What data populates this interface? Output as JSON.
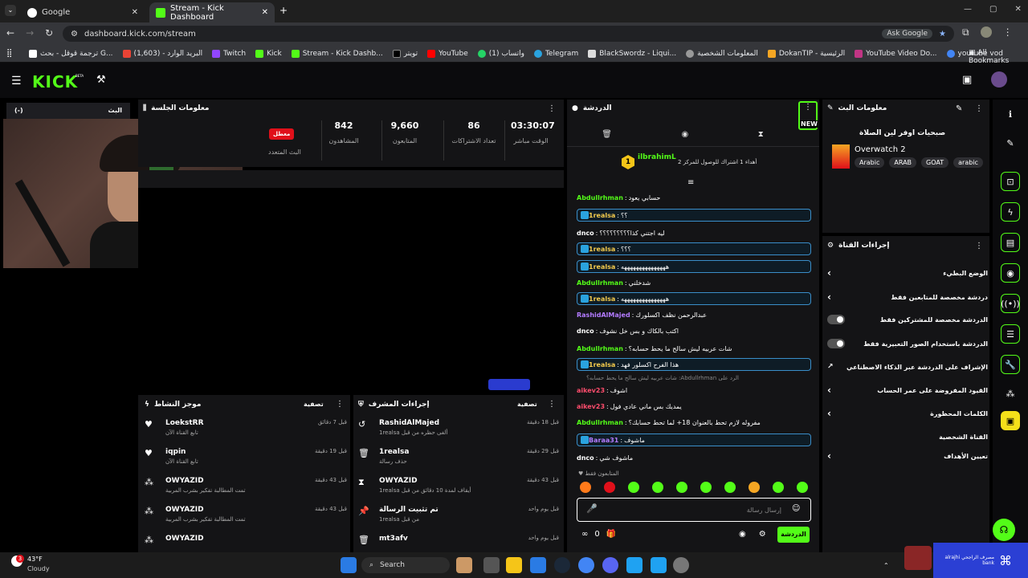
{
  "browser": {
    "tabs": [
      {
        "label": "Google",
        "active": false
      },
      {
        "label": "Stream - Kick Dashboard",
        "active": true
      }
    ],
    "url": "dashboard.kick.com/stream",
    "ask_google": "Ask Google",
    "bookmarks": [
      "ترجمة قوقل - بحث G...",
      "البريد الوارد - (1,603)",
      "Twitch",
      "Kick",
      "Stream - Kick Dashb...",
      "تويتر",
      "YouTube",
      "واتساب (1)",
      "Telegram",
      "BlackSwordz - Liqui...",
      "المعلومات الشخصية",
      "DokanTIP - الرئيسية",
      "YouTube Video Do...",
      "youtube vod"
    ],
    "all_bookmarks": "All Bookmarks"
  },
  "header": {
    "logo": "KICK",
    "beta": "BETA"
  },
  "session": {
    "title": "معلومات الجلسة",
    "status_badge": "معطل",
    "status_label": "البث المتعدد",
    "stats": [
      {
        "value": "842",
        "label": "المشاهدون"
      },
      {
        "value": "9,660",
        "label": "المتابعون"
      },
      {
        "value": "86",
        "label": "تعداد الاشتراكات"
      },
      {
        "value": "03:30:07",
        "label": "الوقت مباشر"
      }
    ]
  },
  "left_tab": "البث",
  "activity": {
    "title": "موجز النشاط",
    "filter": "تصفية",
    "items": [
      {
        "name": "LoekstRR",
        "sub": "تابع القناة الآن",
        "time": "قبل 7 دقائق",
        "icon": "heart-icon"
      },
      {
        "name": "iqpin",
        "sub": "تابع القناة الآن",
        "time": "قبل 19 دقيقة",
        "icon": "heart-icon"
      },
      {
        "name": "OWYAZID",
        "sub": "تمت المطالبة تفكير بشرب المربية",
        "time": "قبل 43 دقيقة",
        "icon": "points-icon"
      },
      {
        "name": "OWYAZID",
        "sub": "تمت المطالبة تفكير بشرب المربية",
        "time": "قبل 43 دقيقة",
        "icon": "points-icon"
      },
      {
        "name": "OWYAZID",
        "sub": "",
        "time": "",
        "icon": "points-icon"
      }
    ]
  },
  "modactions": {
    "title": "إجراءات المشرف",
    "filter": "تصفية",
    "items": [
      {
        "name": "RashidAlMajed",
        "sub": "ألغى حظره من قبل 1realsa",
        "time": "قبل 18 دقيقة",
        "icon": "undo-icon"
      },
      {
        "name": "1realsa",
        "sub": "حذف رسالة",
        "time": "قبل 29 دقيقة",
        "icon": "trash-icon"
      },
      {
        "name": "OWYAZID",
        "sub": "أيقاف لمدة 10 دقائق من قبل 1realsa",
        "time": "قبل 43 دقيقة",
        "icon": "hourglass-icon"
      },
      {
        "name": "تم تثبيت الرسالة",
        "sub": "من قبل 1realsa",
        "time": "قبل يوم واحد",
        "icon": "pin-icon"
      },
      {
        "name": "mt3afv",
        "sub": "",
        "time": "قبل يوم واحد",
        "icon": "trash-icon"
      }
    ]
  },
  "chat": {
    "title": "الدردشة",
    "new_badge": "NEW",
    "pinned_user": "ilbrahimL",
    "pinned_text": "أهداء 1 اشتراك للوصول للمركز 2",
    "pinned_rank": "1",
    "messages": [
      {
        "user": "Abdullrhman",
        "text": "حسابي يعود",
        "color": "#53fc18",
        "hl": false
      },
      {
        "user": "1realsa",
        "text": "؟؟",
        "color": "#f2c94c",
        "hl": true
      },
      {
        "user": "dnco",
        "text": "ليه اجتني كذا؟؟؟؟؟؟؟؟؟",
        "color": "#ffffff",
        "hl": false
      },
      {
        "user": "1realsa",
        "text": "؟؟؟",
        "color": "#f2c94c",
        "hl": true
      },
      {
        "user": "1realsa",
        "text": "هههههههههههههههه",
        "color": "#f2c94c",
        "hl": true
      },
      {
        "user": "Abdullrhman",
        "text": "شدخلني",
        "color": "#53fc18",
        "hl": false
      },
      {
        "user": "1realsa",
        "text": "هههههههههههههههه",
        "color": "#f2c94c",
        "hl": true
      },
      {
        "user": "RashidAlMajed",
        "text": "عبدالرحمن نظف اكسلورك",
        "color": "#b37bff",
        "hl": false
      },
      {
        "user": "dnco",
        "text": "اكتب بالكاك و بس خل نشوف",
        "color": "#ffffff",
        "hl": false
      },
      {
        "user": "Abdullrhman",
        "text": "شات عربيه ليش سالح ما يحط حسابه؟",
        "color": "#53fc18",
        "hl": false
      },
      {
        "user": "1realsa",
        "text": "هذا الفرح اكسلور فهد",
        "color": "#f2c94c",
        "hl": true
      },
      {
        "user": "aikev23",
        "text": "اشوف",
        "color": "#ff4d6d",
        "hl": false
      },
      {
        "user": "aikev23",
        "text": "يمديك بس ماني عادي فول",
        "color": "#ff4d6d",
        "hl": false
      },
      {
        "user": "Abdullrhman",
        "text": "مفروله لازم تحط بالعنوان 18+ لما تحط حسابك؟",
        "color": "#53fc18",
        "hl": false
      },
      {
        "user": "Baraa31",
        "text": "ماشوف",
        "color": "#b37bff",
        "hl": true
      },
      {
        "user": "dnco",
        "text": "ماشوف شي",
        "color": "#ffffff",
        "hl": false
      }
    ],
    "reply_note": "الرد على Abdullrhman: شات عربيه ليش سالح ما يحط حسابه؟",
    "followers_only": "المتابعون فقط",
    "input_placeholder": "إرسال رسالة",
    "send_label": "الدردشة",
    "points": "0"
  },
  "streaminfo": {
    "title": "معلومات البث",
    "stream_title": "صبحيات اوفر لين الصلاة",
    "game": "Overwatch 2",
    "tags": [
      "Arabic",
      "ARAB",
      "GOAT",
      "arabic"
    ]
  },
  "channel_actions": {
    "title": "إجراءات القناة",
    "items": [
      {
        "label": "الوضع البطيء",
        "type": "chevron"
      },
      {
        "label": "دردشة مخصصة للمتابعين فقط",
        "type": "chevron"
      },
      {
        "label": "الدردشة مخصصة للمشتركين فقط",
        "type": "toggle"
      },
      {
        "label": "الدردشة باستخدام الصور التعبيرية فقط",
        "type": "toggle"
      },
      {
        "label": "الإشراف على الدردشة عبر الذكاء الاصطناعي",
        "type": "link"
      },
      {
        "label": "القيود المفروضة على عمر الحساب",
        "type": "chevron"
      },
      {
        "label": "الكلمات المحظورة",
        "type": "chevron"
      },
      {
        "label": "القناة الشخصية",
        "type": "none"
      },
      {
        "label": "تعيين الأهداف",
        "type": "chevron"
      }
    ]
  },
  "taskbar": {
    "weather_temp": "43°F",
    "weather_desc": "Cloudy",
    "search": "Search",
    "bank": "مصرف الراجحي alrajhi bank",
    "badge": "3"
  },
  "colors": {
    "accent": "#53fc18",
    "panel": "#141416",
    "bg": "#000000"
  }
}
